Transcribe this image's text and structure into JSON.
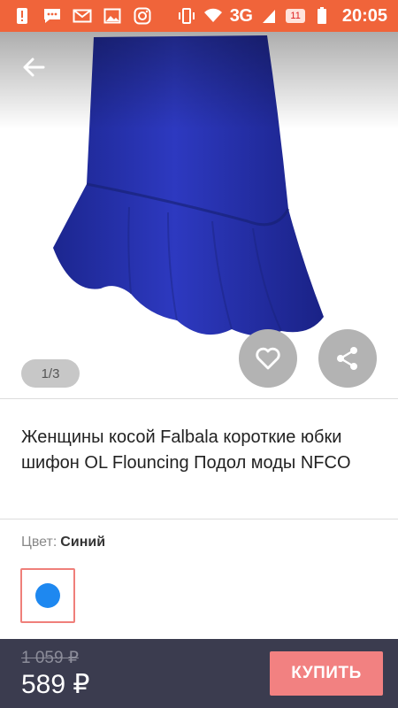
{
  "status_bar": {
    "network": "3G",
    "badge": "11",
    "time": "20:05",
    "icons": [
      "alert-icon",
      "message-icon",
      "mail-icon",
      "image-icon",
      "instagram-icon",
      "vibrate-icon",
      "wifi-icon",
      "signal-icon",
      "battery-icon"
    ]
  },
  "gallery": {
    "pager": "1/3",
    "product_color": "#2a35b8"
  },
  "product": {
    "title": "Женщины косой Falbala короткие юбки шифон OL Flouncing Подол моды NFCO",
    "color_label": "Цвет:",
    "color_value": "Синий",
    "swatch_color": "#1e88f0"
  },
  "purchase": {
    "old_price": "1 059 ₽",
    "price": "589 ₽",
    "buy_label": "КУПИТЬ"
  },
  "colors": {
    "status_bar": "#f0643a",
    "bottom_bar": "#3b3c4f",
    "buy_button": "#f28181",
    "swatch_border": "#ef7f7a"
  }
}
